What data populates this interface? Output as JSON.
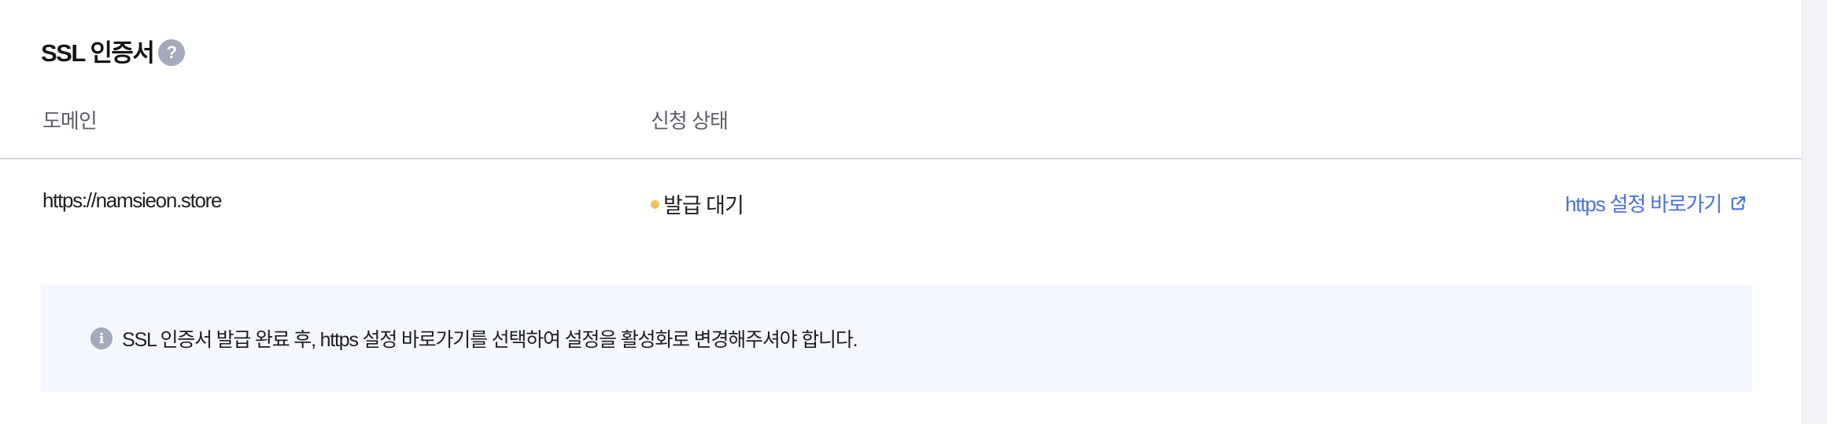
{
  "section": {
    "title": "SSL 인증서",
    "help_icon": "?"
  },
  "table": {
    "headers": {
      "domain": "도메인",
      "status": "신청 상태"
    },
    "rows": [
      {
        "domain": "https://namsieon.store",
        "status": "발급 대기",
        "status_color": "#f0c25a",
        "action_label": "https 설정 바로가기"
      }
    ]
  },
  "notice": {
    "icon": "i",
    "text": "SSL 인증서 발급 완료 후, https 설정 바로가기를 선택하여 설정을 활성화로 변경해주셔야 합니다."
  },
  "colors": {
    "link": "#4a6fe0",
    "notice_bg": "#f4f7fd",
    "icon_gray": "#a4a9bb"
  },
  "icons": {
    "help": "question-icon",
    "external": "external-link-icon",
    "info": "info-icon"
  }
}
